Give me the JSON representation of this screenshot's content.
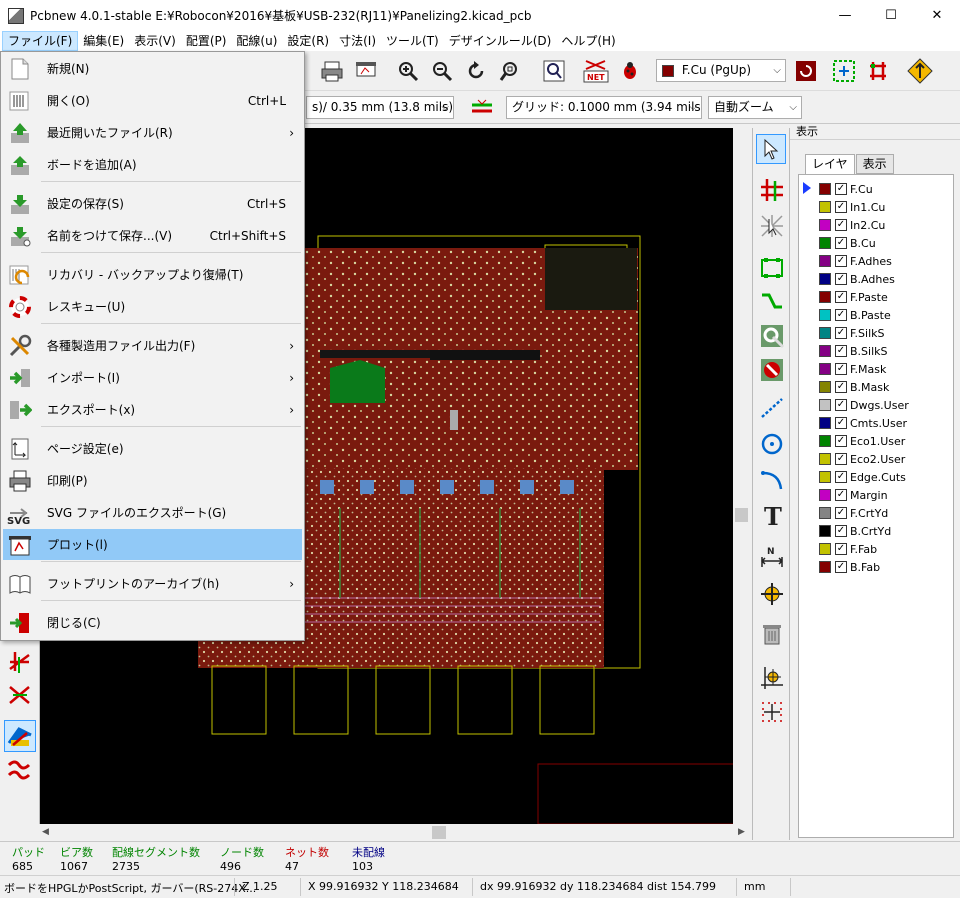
{
  "window": {
    "title": "Pcbnew 4.0.1-stable E:¥Robocon¥2016¥基板¥USB-232(RJ11)¥Panelizing2.kicad_pcb"
  },
  "menubar": [
    "ファイル(F)",
    "編集(E)",
    "表示(V)",
    "配置(P)",
    "配線(u)",
    "設定(R)",
    "寸法(I)",
    "ツール(T)",
    "デザインルール(D)",
    "ヘルプ(H)"
  ],
  "toolbar": {
    "layer_select": "F.Cu (PgUp)",
    "track_width": "s)/ 0.35 mm (13.8 mils) *",
    "grid": "グリッド: 0.1000 mm (3.94 mils)",
    "zoom": "自動ズーム"
  },
  "file_menu": [
    {
      "label": "新規(N)",
      "shortcut": "",
      "submenu": false,
      "icon": "new-icon"
    },
    {
      "label": "開く(O)",
      "shortcut": "Ctrl+L",
      "submenu": false,
      "icon": "open-icon"
    },
    {
      "label": "最近開いたファイル(R)",
      "shortcut": "",
      "submenu": true,
      "icon": "recent-icon"
    },
    {
      "label": "ボードを追加(A)",
      "shortcut": "",
      "submenu": false,
      "icon": "append-icon"
    },
    {
      "label": "設定の保存(S)",
      "shortcut": "Ctrl+S",
      "submenu": false,
      "icon": "save-icon"
    },
    {
      "label": "名前をつけて保存...(V)",
      "shortcut": "Ctrl+Shift+S",
      "submenu": false,
      "icon": "save-as-icon"
    },
    {
      "label": "リカバリ - バックアップより復帰(T)",
      "shortcut": "",
      "submenu": false,
      "icon": "recovery-icon"
    },
    {
      "label": "レスキュー(U)",
      "shortcut": "",
      "submenu": false,
      "icon": "rescue-icon"
    },
    {
      "label": "各種製造用ファイル出力(F)",
      "shortcut": "",
      "submenu": true,
      "icon": "fabrication-icon"
    },
    {
      "label": "インポート(I)",
      "shortcut": "",
      "submenu": true,
      "icon": "import-icon"
    },
    {
      "label": "エクスポート(x)",
      "shortcut": "",
      "submenu": true,
      "icon": "export-icon"
    },
    {
      "label": "ページ設定(e)",
      "shortcut": "",
      "submenu": false,
      "icon": "page-setup-icon"
    },
    {
      "label": "印刷(P)",
      "shortcut": "",
      "submenu": false,
      "icon": "print-icon"
    },
    {
      "label": "SVG ファイルのエクスポート(G)",
      "shortcut": "",
      "submenu": false,
      "icon": "svg-icon"
    },
    {
      "label": "プロット(l)",
      "shortcut": "",
      "submenu": false,
      "icon": "plot-icon"
    },
    {
      "label": "フットプリントのアーカイブ(h)",
      "shortcut": "",
      "submenu": true,
      "icon": "archive-icon"
    },
    {
      "label": "閉じる(C)",
      "shortcut": "",
      "submenu": false,
      "icon": "exit-icon"
    }
  ],
  "right_panel": {
    "header": "表示",
    "tabs": [
      "レイヤ",
      "表示"
    ],
    "layers": [
      {
        "name": "F.Cu",
        "color": "#840000"
      },
      {
        "name": "In1.Cu",
        "color": "#c2c200"
      },
      {
        "name": "In2.Cu",
        "color": "#c200c2"
      },
      {
        "name": "B.Cu",
        "color": "#008400"
      },
      {
        "name": "F.Adhes",
        "color": "#840084"
      },
      {
        "name": "B.Adhes",
        "color": "#000084"
      },
      {
        "name": "F.Paste",
        "color": "#840000"
      },
      {
        "name": "B.Paste",
        "color": "#00c2c2"
      },
      {
        "name": "F.SilkS",
        "color": "#008484"
      },
      {
        "name": "B.SilkS",
        "color": "#840084"
      },
      {
        "name": "F.Mask",
        "color": "#840084"
      },
      {
        "name": "B.Mask",
        "color": "#848400"
      },
      {
        "name": "Dwgs.User",
        "color": "#c2c2c2"
      },
      {
        "name": "Cmts.User",
        "color": "#000084"
      },
      {
        "name": "Eco1.User",
        "color": "#008400"
      },
      {
        "name": "Eco2.User",
        "color": "#c2c200"
      },
      {
        "name": "Edge.Cuts",
        "color": "#c2c200"
      },
      {
        "name": "Margin",
        "color": "#c200c2"
      },
      {
        "name": "F.CrtYd",
        "color": "#848484"
      },
      {
        "name": "B.CrtYd",
        "color": "#000000"
      },
      {
        "name": "F.Fab",
        "color": "#c2c200"
      },
      {
        "name": "B.Fab",
        "color": "#840000"
      }
    ]
  },
  "stats": [
    {
      "label": "パッド",
      "value": "685",
      "color": "#008400"
    },
    {
      "label": "ビア数",
      "value": "1067",
      "color": "#008400"
    },
    {
      "label": "配線セグメント数",
      "value": "2735",
      "color": "#008400"
    },
    {
      "label": "ノード数",
      "value": "496",
      "color": "#008400"
    },
    {
      "label": "ネット数",
      "value": "47",
      "color": "#c20000"
    },
    {
      "label": "未配線",
      "value": "103",
      "color": "#000084"
    }
  ],
  "status": {
    "message": "ボードをHPGLかPostScript, ガーバー(RS-274X...",
    "zoom": "Z 1.25",
    "abs_coords": "X 99.916932  Y 118.234684",
    "rel_coords": "dx 99.916932  dy 118.234684  dist 154.799",
    "units": "mm"
  }
}
